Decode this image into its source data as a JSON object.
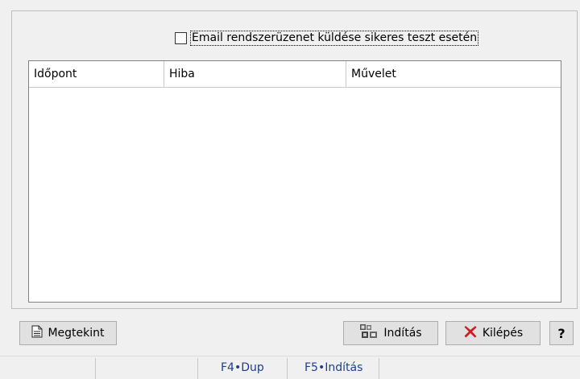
{
  "checkbox": {
    "label": "Email rendszerüzenet küldése sikeres teszt esetén",
    "checked": false
  },
  "table": {
    "columns": [
      "Időpont",
      "Hiba",
      "Művelet"
    ],
    "rows": []
  },
  "buttons": {
    "view": "Megtekint",
    "start": "Indítás",
    "exit": "Kilépés",
    "help": "?"
  },
  "icons": {
    "view": "document-view-icon",
    "start": "process-gears-icon",
    "exit": "red-x-icon"
  },
  "statusbar": {
    "cells": [
      "",
      "",
      "F4•Dup",
      "F5•Indítás"
    ]
  },
  "colors": {
    "exit_icon": "#cc1f1f",
    "status_text": "#1c3f8c"
  }
}
